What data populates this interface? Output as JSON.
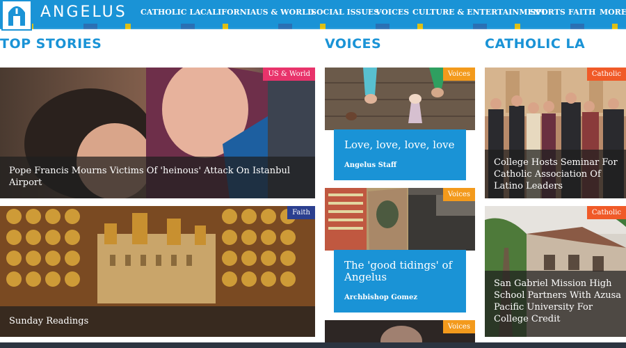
{
  "header": {
    "brand": "ANGELUS",
    "nav": [
      "CATHOLIC LA",
      "CALIFORNIA",
      "US & WORLD",
      "SOCIAL ISSUES",
      "VOICES",
      "CULTURE & ENTERTAINMENT",
      "SPORTS",
      "FAITH",
      "MORE"
    ]
  },
  "sections": {
    "top_stories": "TOP STORIES",
    "voices": "VOICES",
    "catholic_la": "CATHOLIC LA"
  },
  "top_stories": [
    {
      "tag": "US & World",
      "title": "Pope Francis Mourns Victims Of 'heinous' Attack On Istanbul Airport"
    },
    {
      "tag": "Faith",
      "title": "Sunday Readings"
    }
  ],
  "voices": [
    {
      "tag": "Voices",
      "title": "Love, love, love, love",
      "author": "Angelus Staff"
    },
    {
      "tag": "Voices",
      "title": "The 'good tidings' of Angelus",
      "author": "Archbishop Gomez"
    },
    {
      "tag": "Voices"
    }
  ],
  "catholic_la": [
    {
      "tag": "Catholic",
      "title": "College Hosts Seminar For Catholic Association Of Latino Leaders"
    },
    {
      "tag": "Catholic",
      "title": "San Gabriel Mission High School Partners With Azusa Pacific University For College Credit"
    }
  ],
  "colors": {
    "brand_blue": "#1a93d6",
    "tag_pink": "#e8336b",
    "tag_navy": "#2b3f8f",
    "tag_orange": "#f39a1c",
    "tag_red_orange": "#f05a28"
  }
}
